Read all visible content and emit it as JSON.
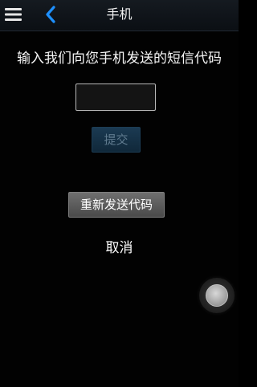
{
  "topbar": {
    "title": "手机",
    "menu_icon": "hamburger-menu-icon",
    "back_icon": "chevron-left-icon",
    "accent_color": "#1e90ff"
  },
  "verification": {
    "instruction": "输入我们向您手机发送的短信代码",
    "code_value": "",
    "submit_label": "提交",
    "resend_label": "重新发送代码",
    "cancel_label": "取消"
  },
  "floating_button": {
    "icon": "assistive-touch-icon"
  }
}
